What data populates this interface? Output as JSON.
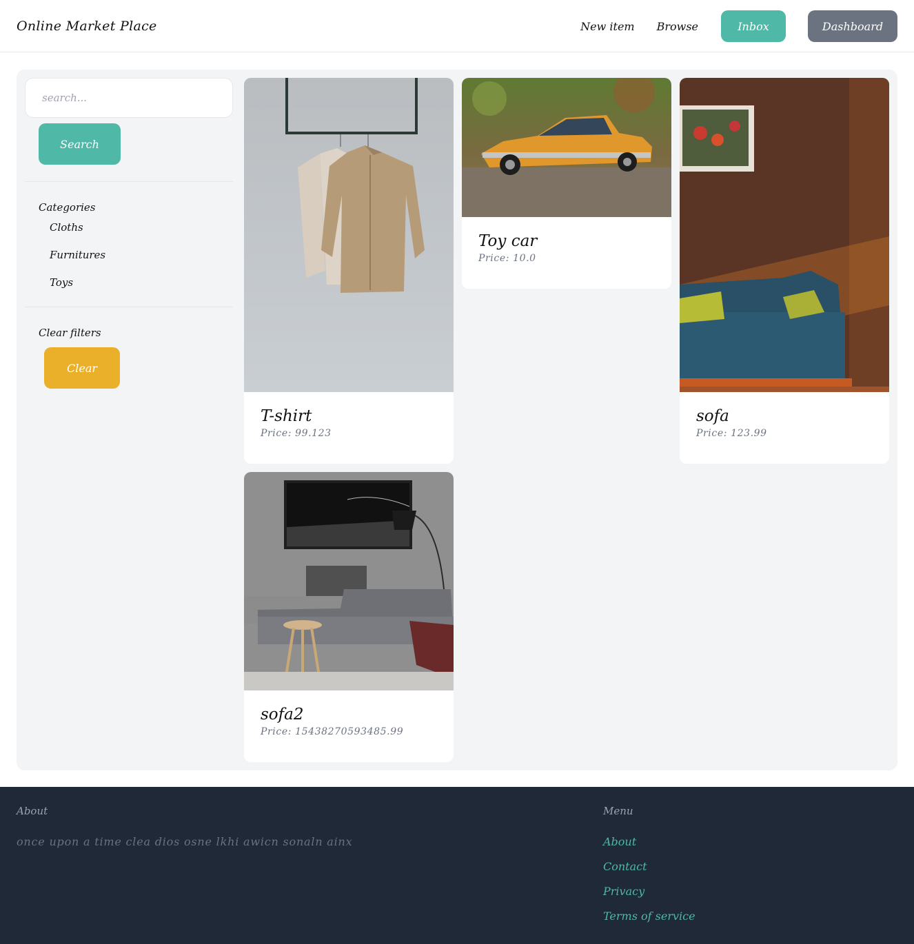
{
  "brand": "Online Market Place",
  "nav": {
    "new_item": "New item",
    "browse": "Browse",
    "inbox": "Inbox",
    "dashboard": "Dashboard"
  },
  "sidebar": {
    "search_placeholder": "search...",
    "search_button": "Search",
    "categories_title": "Categories",
    "categories": [
      "Cloths",
      "Furnitures",
      "Toys"
    ],
    "clear_title": "Clear filters",
    "clear_button": "Clear"
  },
  "items": [
    {
      "name": "T-shirt",
      "price": "Price: 99.123",
      "image": "shirts-on-hanger"
    },
    {
      "name": "Toy car",
      "price": "Price: 10.0",
      "image": "orange-toy-car"
    },
    {
      "name": "sofa",
      "price": "Price: 123.99",
      "image": "blue-sofa"
    },
    {
      "name": "sofa2",
      "price": "Price: 15438270593485.99",
      "image": "living-room-sofa"
    }
  ],
  "footer": {
    "about_title": "About",
    "about_text": "once upon a time clea dios osne lkhi awicn sonaln ainx",
    "menu_title": "Menu",
    "menu": [
      "About",
      "Contact",
      "Privacy",
      "Terms of service"
    ]
  },
  "colors": {
    "teal": "#4fb8a6",
    "gray_button": "#6b7280",
    "yellow": "#eab02a",
    "footer_bg": "#1f2937",
    "panel_bg": "#f3f4f6"
  }
}
